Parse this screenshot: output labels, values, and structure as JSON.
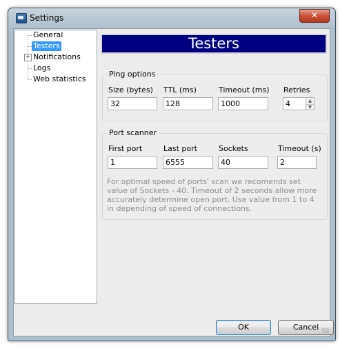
{
  "window": {
    "title": "Settings",
    "close_symbol": "✕"
  },
  "tree": {
    "items": [
      {
        "label": "General",
        "selected": false
      },
      {
        "label": "Testers",
        "selected": true
      },
      {
        "label": "Notifications",
        "expander": "+"
      },
      {
        "label": "Logs"
      },
      {
        "label": "Web statistics"
      }
    ]
  },
  "header": {
    "title": "Testers",
    "background": "#000080"
  },
  "ping": {
    "group_label": "Ping options",
    "size_label": "Size (bytes)",
    "size_value": "32",
    "ttl_label": "TTL (ms)",
    "ttl_value": "128",
    "timeout_label": "Timeout (ms)",
    "timeout_value": "1000",
    "retries_label": "Retries",
    "retries_value": "4"
  },
  "port": {
    "group_label": "Port scanner",
    "first_label": "First port",
    "first_value": "1",
    "last_label": "Last port",
    "last_value": "6555",
    "sockets_label": "Sockets",
    "sockets_value": "40",
    "timeout_label": "Timeout (s)",
    "timeout_value": "2",
    "note": "For optimal speed of ports' scan we recomends set value of Sockets - 40. Timeout of 2 seconds allow more accurately determine open port. Use value from 1 to 4 in depending of speed of connections."
  },
  "buttons": {
    "ok": "OK",
    "cancel": "Cancel"
  },
  "icons": {
    "app": "settings-app-icon",
    "close": "close-icon",
    "spin_up": "arrow-up-icon",
    "spin_down": "arrow-down-icon"
  }
}
